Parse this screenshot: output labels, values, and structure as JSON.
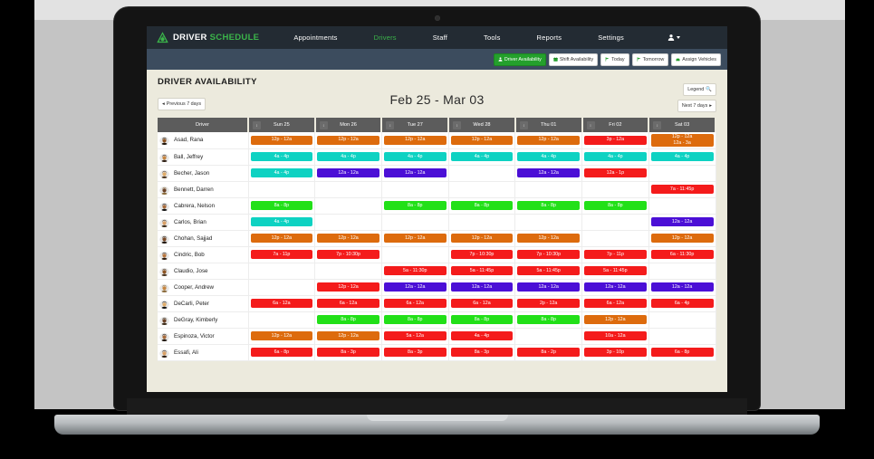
{
  "brand": {
    "word1": "DRIVER",
    "word2": "SCHEDULE",
    "logo_icon": "speedometer-logo-icon"
  },
  "colors": {
    "navbar": "#232b33",
    "subbar": "#3c4c5e",
    "accent_green": "#3bb54a",
    "page_bg": "#eceadd",
    "shift_orange": "#dd6b0d",
    "shift_teal": "#0ed2c2",
    "shift_purple": "#4b0fd6",
    "shift_red": "#f41b1b",
    "shift_green": "#22e018"
  },
  "nav": {
    "items": [
      {
        "label": "Appointments",
        "active": false
      },
      {
        "label": "Drivers",
        "active": true
      },
      {
        "label": "Staff",
        "active": false
      },
      {
        "label": "Tools",
        "active": false
      },
      {
        "label": "Reports",
        "active": false
      },
      {
        "label": "Settings",
        "active": false
      }
    ],
    "user_menu": {
      "icon": "user-icon",
      "caret": "chevron-down-icon"
    }
  },
  "subbar": {
    "buttons": [
      {
        "label": "Driver Availability",
        "icon": "user-icon",
        "primary": true
      },
      {
        "label": "Shift Availability",
        "icon": "calendar-icon",
        "primary": false
      },
      {
        "label": "Today",
        "icon": "flag-icon",
        "primary": false
      },
      {
        "label": "Tomorrow",
        "icon": "flag-icon",
        "primary": false
      },
      {
        "label": "Assign Vehicles",
        "icon": "car-icon",
        "primary": false
      }
    ]
  },
  "page": {
    "title": "DRIVER AVAILABILITY",
    "date_range": "Feb 25 - Mar 03",
    "prev_label": "Previous 7 days",
    "next_label": "Next 7 days",
    "legend_label": "Legend",
    "legend_icon": "search-icon",
    "prev_icon": "caret-left-icon",
    "next_icon": "caret-right-icon"
  },
  "table": {
    "driver_header": "Driver",
    "sort_icon": "sort-icon",
    "day_headers": [
      "Sun 25",
      "Mon 26",
      "Tue 27",
      "Wed 28",
      "Thu 01",
      "Fri 02",
      "Sat 03"
    ],
    "rows": [
      {
        "name": "Asad, Rana",
        "avatar": "avatar-asad",
        "cells": [
          {
            "text": "12p - 12a",
            "color": "orange"
          },
          {
            "text": "12p - 12a",
            "color": "orange"
          },
          {
            "text": "12p - 12a",
            "color": "orange"
          },
          {
            "text": "12p - 12a",
            "color": "orange"
          },
          {
            "text": "12p - 12a",
            "color": "orange"
          },
          {
            "text": "3p - 12a",
            "color": "red"
          },
          {
            "text": "12p - 12a\n12a - 3a",
            "color": "orange"
          }
        ]
      },
      {
        "name": "Ball, Jeffrey",
        "avatar": "avatar-ball",
        "cells": [
          {
            "text": "4a - 4p",
            "color": "teal"
          },
          {
            "text": "4a - 4p",
            "color": "teal"
          },
          {
            "text": "4a - 4p",
            "color": "teal"
          },
          {
            "text": "4a - 4p",
            "color": "teal"
          },
          {
            "text": "4a - 4p",
            "color": "teal"
          },
          {
            "text": "4a - 4p",
            "color": "teal"
          },
          {
            "text": "4a - 4p",
            "color": "teal"
          }
        ]
      },
      {
        "name": "Becher, Jason",
        "avatar": "avatar-becher",
        "cells": [
          {
            "text": "4a - 4p",
            "color": "teal"
          },
          {
            "text": "12a - 12a",
            "color": "purple"
          },
          {
            "text": "12a - 12a",
            "color": "purple"
          },
          {
            "text": "",
            "color": "none"
          },
          {
            "text": "12a - 12a",
            "color": "purple"
          },
          {
            "text": "12a - 1p",
            "color": "red"
          },
          {
            "text": "",
            "color": "none"
          }
        ]
      },
      {
        "name": "Bennett, Darren",
        "avatar": "avatar-bennett",
        "cells": [
          {
            "text": "",
            "color": "none"
          },
          {
            "text": "",
            "color": "none"
          },
          {
            "text": "",
            "color": "none"
          },
          {
            "text": "",
            "color": "none"
          },
          {
            "text": "",
            "color": "none"
          },
          {
            "text": "",
            "color": "none"
          },
          {
            "text": "7a - 11:45p",
            "color": "red"
          }
        ]
      },
      {
        "name": "Cabrera, Nelson",
        "avatar": "avatar-cabrera",
        "cells": [
          {
            "text": "8a - 8p",
            "color": "green"
          },
          {
            "text": "",
            "color": "none"
          },
          {
            "text": "8a - 8p",
            "color": "green"
          },
          {
            "text": "8a - 8p",
            "color": "green"
          },
          {
            "text": "8a - 8p",
            "color": "green"
          },
          {
            "text": "8a - 8p",
            "color": "green"
          },
          {
            "text": "",
            "color": "none"
          }
        ]
      },
      {
        "name": "Carlos, Brian",
        "avatar": "avatar-carlos",
        "cells": [
          {
            "text": "4a - 4p",
            "color": "teal"
          },
          {
            "text": "",
            "color": "none"
          },
          {
            "text": "",
            "color": "none"
          },
          {
            "text": "",
            "color": "none"
          },
          {
            "text": "",
            "color": "none"
          },
          {
            "text": "",
            "color": "none"
          },
          {
            "text": "12a - 12a",
            "color": "purple"
          }
        ]
      },
      {
        "name": "Chohan, Sajjad",
        "avatar": "avatar-chohan",
        "cells": [
          {
            "text": "12p - 12a",
            "color": "orange"
          },
          {
            "text": "12p - 12a",
            "color": "orange"
          },
          {
            "text": "12p - 12a",
            "color": "orange"
          },
          {
            "text": "12p - 12a",
            "color": "orange"
          },
          {
            "text": "12p - 12a",
            "color": "orange"
          },
          {
            "text": "",
            "color": "none"
          },
          {
            "text": "12p - 12a",
            "color": "orange"
          }
        ]
      },
      {
        "name": "Cindric, Bob",
        "avatar": "avatar-cindric",
        "cells": [
          {
            "text": "7a - 11p",
            "color": "red"
          },
          {
            "text": "7p - 10:30p",
            "color": "red"
          },
          {
            "text": "",
            "color": "none"
          },
          {
            "text": "7p - 10:30p",
            "color": "red"
          },
          {
            "text": "7p - 10:30p",
            "color": "red"
          },
          {
            "text": "7p - 11p",
            "color": "red"
          },
          {
            "text": "6a - 11:30p",
            "color": "red"
          }
        ]
      },
      {
        "name": "Claudio, Jose",
        "avatar": "avatar-claudio",
        "cells": [
          {
            "text": "",
            "color": "none"
          },
          {
            "text": "",
            "color": "none"
          },
          {
            "text": "5a - 11:30p",
            "color": "red"
          },
          {
            "text": "5a - 11:45p",
            "color": "red"
          },
          {
            "text": "5a - 11:45p",
            "color": "red"
          },
          {
            "text": "5a - 11:45p",
            "color": "red"
          },
          {
            "text": "",
            "color": "none"
          }
        ]
      },
      {
        "name": "Cooper, Andrew",
        "avatar": "avatar-cooper",
        "cells": [
          {
            "text": "",
            "color": "none"
          },
          {
            "text": "12p - 12a",
            "color": "red"
          },
          {
            "text": "12a - 12a",
            "color": "purple"
          },
          {
            "text": "12a - 12a",
            "color": "purple"
          },
          {
            "text": "12a - 12a",
            "color": "purple"
          },
          {
            "text": "12a - 12a",
            "color": "purple"
          },
          {
            "text": "12a - 12a",
            "color": "purple"
          }
        ]
      },
      {
        "name": "DeCarli, Peter",
        "avatar": "avatar-decarli",
        "cells": [
          {
            "text": "6a - 12a",
            "color": "red"
          },
          {
            "text": "6a - 12a",
            "color": "red"
          },
          {
            "text": "6a - 12a",
            "color": "red"
          },
          {
            "text": "6a - 12a",
            "color": "red"
          },
          {
            "text": "2p - 12a",
            "color": "red"
          },
          {
            "text": "6a - 12a",
            "color": "red"
          },
          {
            "text": "6a - 4p",
            "color": "red"
          }
        ]
      },
      {
        "name": "DeGray, Kimberly",
        "avatar": "avatar-degray",
        "cells": [
          {
            "text": "",
            "color": "none"
          },
          {
            "text": "8a - 8p",
            "color": "green"
          },
          {
            "text": "8a - 8p",
            "color": "green"
          },
          {
            "text": "8a - 8p",
            "color": "green"
          },
          {
            "text": "8a - 8p",
            "color": "green"
          },
          {
            "text": "12p - 12a",
            "color": "orange"
          },
          {
            "text": "",
            "color": "none"
          }
        ]
      },
      {
        "name": "Espinoza, Victor",
        "avatar": "avatar-espinoza",
        "cells": [
          {
            "text": "12p - 12a",
            "color": "orange"
          },
          {
            "text": "12p - 12a",
            "color": "orange"
          },
          {
            "text": "5a - 12a",
            "color": "red"
          },
          {
            "text": "4a - 4p",
            "color": "red"
          },
          {
            "text": "",
            "color": "none"
          },
          {
            "text": "10a - 12a",
            "color": "red"
          },
          {
            "text": "",
            "color": "none"
          }
        ]
      },
      {
        "name": "Essafi, Ali",
        "avatar": "avatar-essafi",
        "cells": [
          {
            "text": "6a - 8p",
            "color": "red"
          },
          {
            "text": "8a - 3p",
            "color": "red"
          },
          {
            "text": "8a - 3p",
            "color": "red"
          },
          {
            "text": "8a - 3p",
            "color": "red"
          },
          {
            "text": "8a - 2p",
            "color": "red"
          },
          {
            "text": "3p - 10p",
            "color": "red"
          },
          {
            "text": "6a - 8p",
            "color": "red"
          }
        ]
      }
    ]
  }
}
